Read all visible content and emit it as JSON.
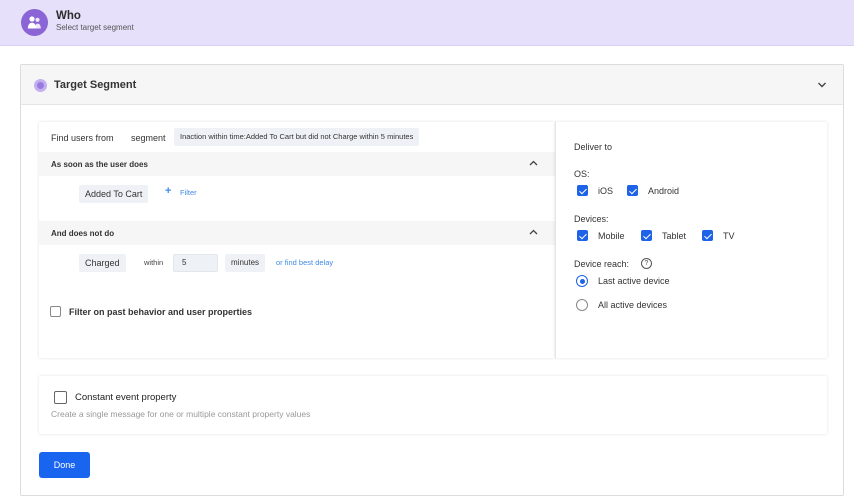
{
  "header": {
    "title": "Who",
    "subtitle": "Select target segment",
    "icon": "users-icon",
    "avatar_color": "#8b64d6",
    "background": "#e6e0fa"
  },
  "panel": {
    "title": "Target Segment",
    "chevron_icon": "chevron-down-icon"
  },
  "find": {
    "label": "Find users from",
    "segment_label": "segment",
    "segment_value": "Inaction within time:Added To Cart but did not Charge within 5 minutes"
  },
  "does": {
    "header": "As soon as the user does",
    "event": "Added To Cart",
    "filter_plus": "+",
    "filter_link": "Filter"
  },
  "not_do": {
    "header": "And does not do",
    "event": "Charged",
    "within_label": "within",
    "within_value": "5",
    "unit": "minutes",
    "delay_link": "or find best delay"
  },
  "past_behavior": {
    "label": "Filter on past behavior and user properties",
    "checked": false
  },
  "deliver": {
    "title": "Deliver to",
    "os_label": "OS:",
    "os_options": [
      {
        "label": "iOS",
        "checked": true
      },
      {
        "label": "Android",
        "checked": true
      }
    ],
    "devices_label": "Devices:",
    "device_options": [
      {
        "label": "Mobile",
        "checked": true
      },
      {
        "label": "Tablet",
        "checked": true
      },
      {
        "label": "TV",
        "checked": true
      }
    ],
    "reach_label": "Device reach:",
    "help_icon": "?",
    "reach_options": [
      {
        "label": "Last active device",
        "selected": true
      },
      {
        "label": "All active devices",
        "selected": false
      }
    ]
  },
  "constant": {
    "title": "Constant event property",
    "subtitle": "Create a single message for one or multiple constant property values",
    "checked": false
  },
  "done_label": "Done",
  "colors": {
    "accent": "#1a65f0",
    "link": "#3d8be8",
    "chip_bg": "#eef1f6"
  }
}
